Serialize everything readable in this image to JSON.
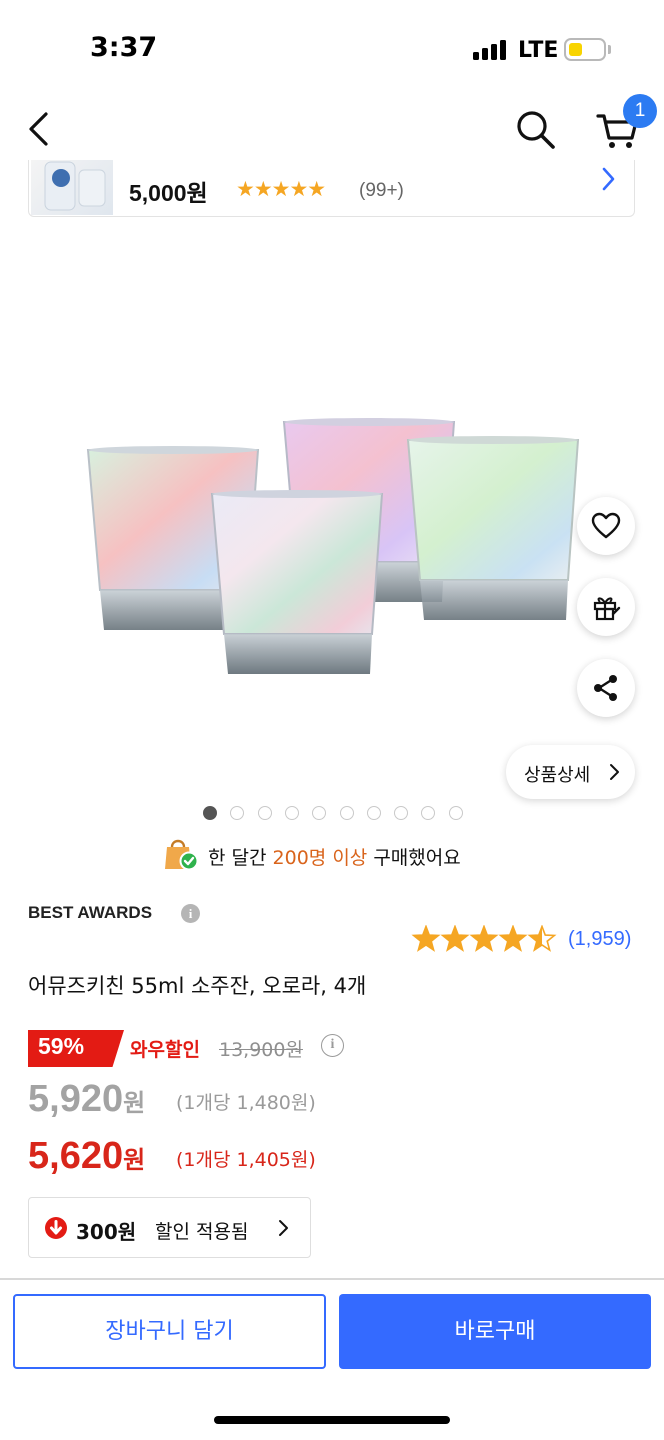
{
  "status_bar": {
    "time": "3:37",
    "network": "LTE"
  },
  "nav": {
    "cart_count": "1",
    "icons": [
      "chevron-left-icon",
      "search-icon",
      "cart-icon"
    ]
  },
  "mini_bar": {
    "price": "5,000원",
    "stars": "★★★★★",
    "review_count": "(99+)"
  },
  "gallery": {
    "detail_label": "상품상세",
    "page_count": 10,
    "active_index": 0,
    "side_icons": [
      "heart-icon",
      "gift-icon",
      "share-icon"
    ]
  },
  "notice": {
    "prefix": "한 달간 ",
    "highlight": "200명 이상",
    "suffix": " 구매했어요"
  },
  "awards_label": "BEST AWARDS",
  "rating": {
    "value": 4.5,
    "count": "(1,959)"
  },
  "product": {
    "title": "어뮤즈키친 55ml 소주잔, 오로라, 4개"
  },
  "pricing": {
    "discount_pct": "59%",
    "wow_label": "와우할인",
    "original_price": "13,900원",
    "regular_price": "5,920",
    "regular_won": "원",
    "regular_unit": "(1개당 1,480원)",
    "sale_price": "5,620",
    "sale_won": "원",
    "sale_unit": "(1개당 1,405원)",
    "coupon_amount": "300원",
    "coupon_text": "할인 적용됨"
  },
  "actions": {
    "cart_label": "장바구니 담기",
    "buy_label": "바로구매"
  },
  "colors": {
    "accent": "#346aff",
    "sale_red": "#e31b14",
    "star": "#f5a623",
    "notice_orange": "#d9641c"
  }
}
